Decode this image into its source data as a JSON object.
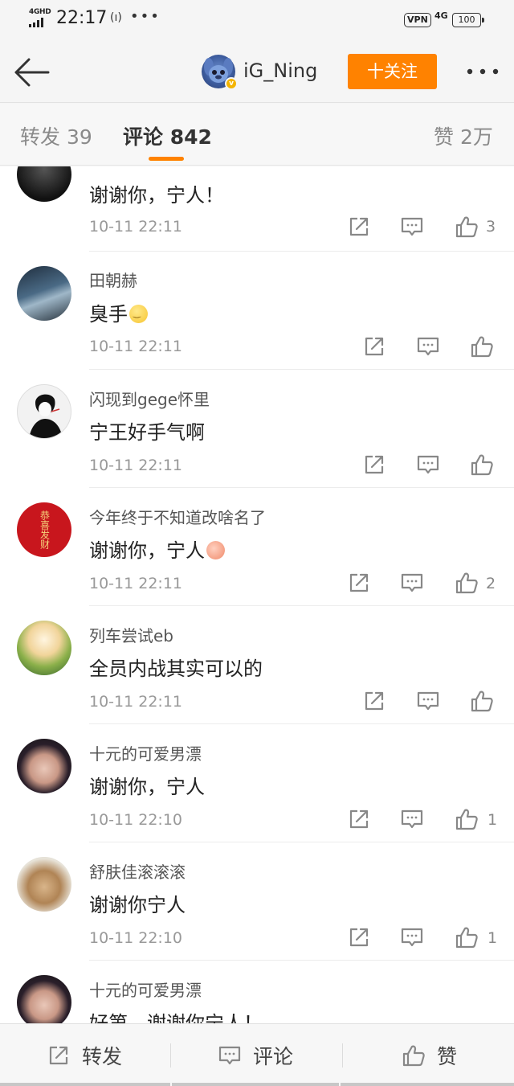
{
  "status_bar": {
    "network_label": "4GHD",
    "time": "22:17",
    "nfc": "(ı)",
    "dots": "•••",
    "vpn": "VPN",
    "network_type": "4G",
    "battery": "100"
  },
  "header": {
    "back_icon": "arrow-left-icon",
    "username": "iG_Ning",
    "follow_label": "十关注",
    "more_icon": "more-dots-icon",
    "accent_color": "#ff8200"
  },
  "tabs": {
    "repost": "转发 39",
    "comment": "评论 842",
    "likes": "赞 2万"
  },
  "comments": [
    {
      "name": "",
      "text": "谢谢你，宁人！",
      "time": "10-11 22:11",
      "likes": "3"
    },
    {
      "name": "田朝赫",
      "text": "臭手",
      "emoji": "smile-emoji",
      "time": "10-11 22:11",
      "likes": ""
    },
    {
      "name": "闪现到gege怀里",
      "text": "宁王好手气啊",
      "time": "10-11 22:11",
      "likes": ""
    },
    {
      "name": "今年终于不知道改啥名了",
      "text": "谢谢你，宁人",
      "emoji": "laugh-emoji",
      "time": "10-11 22:11",
      "likes": "2",
      "avatar_text": "恭喜发财"
    },
    {
      "name": "列车尝试eb",
      "text": "全员内战其实可以的",
      "time": "10-11 22:11",
      "likes": ""
    },
    {
      "name": "十元的可爱男漂",
      "text": "谢谢你，宁人",
      "time": "10-11 22:10",
      "likes": "1"
    },
    {
      "name": "舒肤佳滚滚滚",
      "text": "谢谢你宁人",
      "time": "10-11 22:10",
      "likes": "1"
    },
    {
      "name": "十元的可爱男漂",
      "text": "好第，谢谢你宁人！",
      "time": "",
      "likes": ""
    }
  ],
  "bottom_bar": {
    "repost": "转发",
    "comment": "评论",
    "like": "赞"
  }
}
